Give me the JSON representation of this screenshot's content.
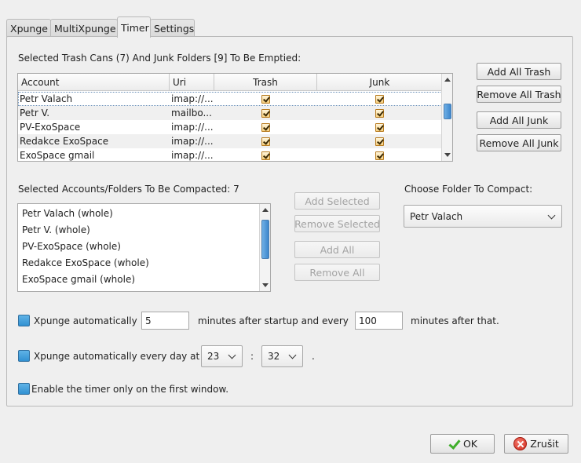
{
  "tabs": [
    {
      "label": "Xpunge"
    },
    {
      "label": "MultiXpunge"
    },
    {
      "label": "Timer",
      "active": true
    },
    {
      "label": "Settings"
    }
  ],
  "trash_section": {
    "title": "Selected Trash Cans (7) And Junk Folders [9] To Be Emptied:",
    "columns": [
      "Account",
      "Uri",
      "Trash",
      "Junk"
    ],
    "rows": [
      {
        "account": "Petr Valach",
        "uri": "imap://...",
        "trash": true,
        "junk": true
      },
      {
        "account": "Petr V.",
        "uri": "mailbo...",
        "trash": true,
        "junk": true
      },
      {
        "account": "PV-ExoSpace",
        "uri": "imap://...",
        "trash": true,
        "junk": true
      },
      {
        "account": "Redakce ExoSpace",
        "uri": "imap://...",
        "trash": true,
        "junk": true
      },
      {
        "account": "ExoSpace gmail",
        "uri": "imap://...",
        "trash": true,
        "junk": true
      }
    ],
    "buttons": {
      "add_all_trash": "Add All Trash",
      "remove_all_trash": "Remove All Trash",
      "add_all_junk": "Add All Junk",
      "remove_all_junk": "Remove All Junk"
    }
  },
  "compact_section": {
    "title": "Selected Accounts/Folders To Be Compacted: 7",
    "items": [
      "Petr Valach (whole)",
      "Petr V. (whole)",
      "PV-ExoSpace (whole)",
      "Redakce ExoSpace (whole)",
      "ExoSpace gmail (whole)"
    ],
    "buttons": {
      "add_selected": "Add Selected",
      "remove_selected": "Remove Selected",
      "add_all": "Add All",
      "remove_all": "Remove All"
    },
    "choose_label": "Choose Folder To Compact:",
    "choose_value": "Petr Valach"
  },
  "timer": {
    "auto_label": "Xpunge automatically",
    "startup_minutes": "5",
    "after_startup_label": "minutes after startup and every",
    "every_minutes": "100",
    "after_that_label": "minutes after that.",
    "daily_label": "Xpunge automatically every day at",
    "hour": "23",
    "time_separator": ":",
    "minute": "32",
    "daily_suffix": ".",
    "first_window_label": "Enable the timer only on the first window."
  },
  "footer": {
    "ok_label": "OK",
    "cancel_label": "Zrušit"
  }
}
